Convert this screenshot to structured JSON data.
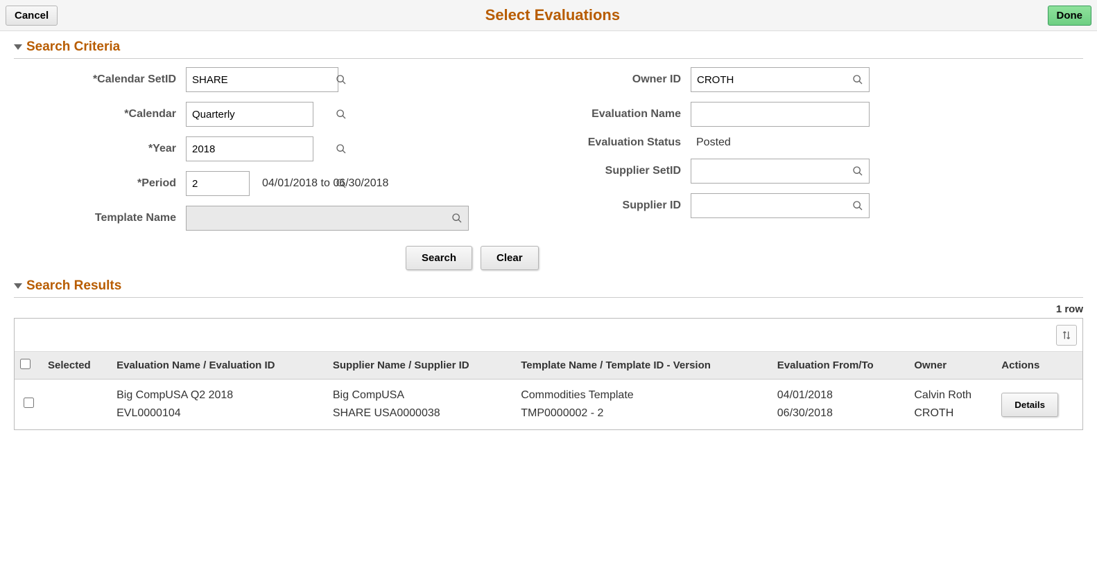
{
  "header": {
    "cancel_label": "Cancel",
    "title": "Select Evaluations",
    "done_label": "Done"
  },
  "sections": {
    "criteria_title": "Search Criteria",
    "results_title": "Search Results"
  },
  "criteria": {
    "labels": {
      "calendar_setid": "*Calendar SetID",
      "calendar": "*Calendar",
      "year": "*Year",
      "period": "*Period",
      "template_name": "Template Name",
      "owner_id": "Owner ID",
      "evaluation_name": "Evaluation Name",
      "evaluation_status": "Evaluation Status",
      "supplier_setid": "Supplier SetID",
      "supplier_id": "Supplier ID"
    },
    "values": {
      "calendar_setid": "SHARE",
      "calendar": "Quarterly",
      "year": "2018",
      "period": "2",
      "period_range": "04/01/2018  to 06/30/2018",
      "template_name": "",
      "owner_id": "CROTH",
      "evaluation_name": "",
      "evaluation_status": "Posted",
      "supplier_setid": "",
      "supplier_id": ""
    },
    "buttons": {
      "search": "Search",
      "clear": "Clear"
    }
  },
  "results": {
    "row_count": "1 row",
    "columns": {
      "selected": "Selected",
      "eval": "Evaluation Name / Evaluation ID",
      "supplier": "Supplier Name / Supplier ID",
      "template": "Template Name / Template ID - Version",
      "fromto": "Evaluation From/To",
      "owner": "Owner",
      "actions": "Actions"
    },
    "rows": [
      {
        "eval_name": "Big CompUSA Q2 2018",
        "eval_id": "EVL0000104",
        "supplier_name": "Big CompUSA",
        "supplier_id": "SHARE   USA0000038",
        "template_name": "Commodities Template",
        "template_id": "TMP0000002 - 2",
        "from": "04/01/2018",
        "to": "06/30/2018",
        "owner_name": "Calvin Roth",
        "owner_id": "CROTH",
        "action_label": "Details"
      }
    ]
  }
}
